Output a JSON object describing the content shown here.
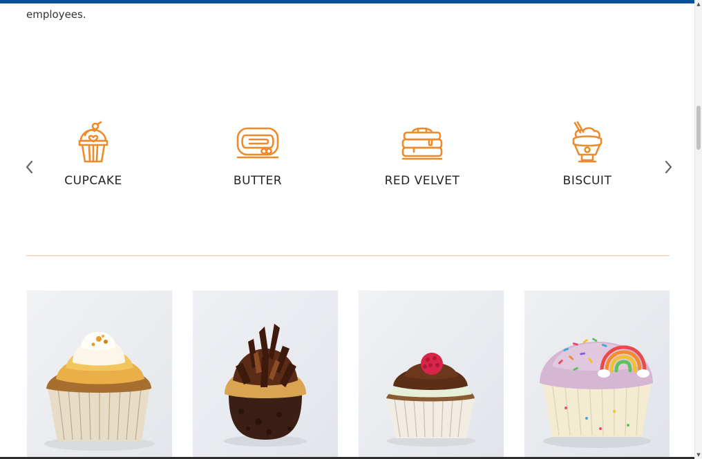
{
  "page": {
    "intro_text": "employees."
  },
  "categories": {
    "items": [
      {
        "label": "CUPCAKE",
        "icon": "cupcake-icon"
      },
      {
        "label": "BUTTER",
        "icon": "butter-roll-icon"
      },
      {
        "label": "RED VELVET",
        "icon": "layer-cake-icon"
      },
      {
        "label": "BISCUIT",
        "icon": "sundae-icon"
      }
    ],
    "prev_icon": "chevron-left-icon",
    "next_icon": "chevron-right-icon"
  },
  "products": [
    {
      "name": "vanilla-cupcake-photo"
    },
    {
      "name": "chocolate-cupcake-photo"
    },
    {
      "name": "raspberry-cupcake-photo"
    },
    {
      "name": "rainbow-cupcake-photo"
    }
  ],
  "colors": {
    "accent": "#ee8a2a",
    "top_bar": "#0a4f9a",
    "divider": "#f0c896"
  }
}
